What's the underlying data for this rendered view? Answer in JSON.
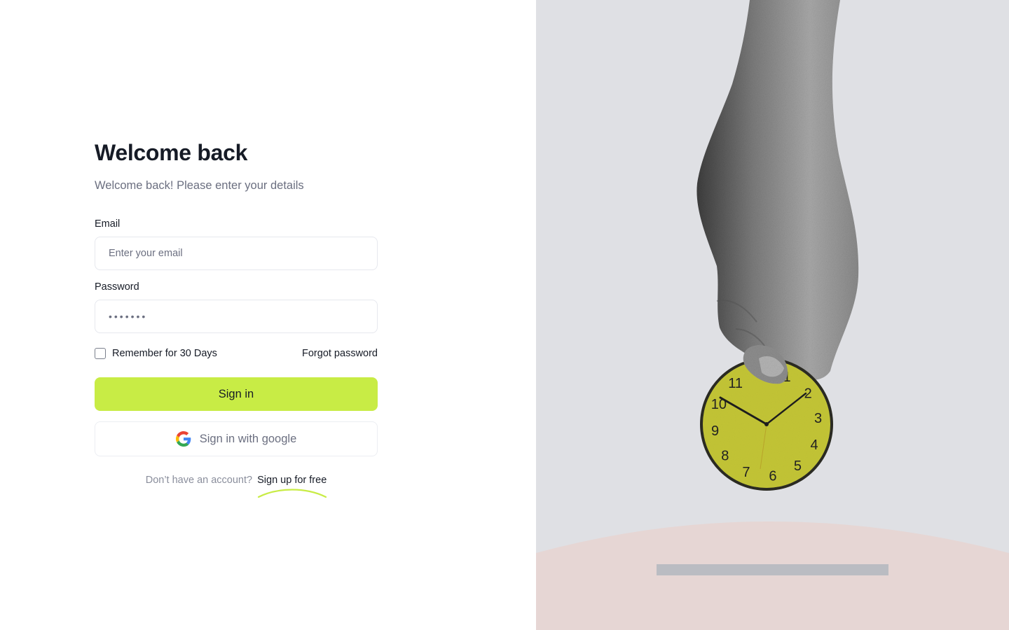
{
  "form": {
    "title": "Welcome back",
    "subtitle": "Welcome back! Please enter your details",
    "email_label": "Email",
    "email_placeholder": "Enter your email",
    "password_label": "Password",
    "password_value": "•••••••",
    "remember_label": "Remember for 30 Days",
    "remember_checked": false,
    "forgot_label": "Forgot password",
    "signin_label": "Sign in",
    "google_label": "Sign in with google",
    "signup_question": "Don’t have an account?",
    "signup_link": "Sign up for free"
  },
  "colors": {
    "accent": "#c8ec45",
    "text_primary": "#161b26",
    "text_muted": "#6b6f80",
    "panel_bg": "#dfe0e4",
    "floor": "#e6d6d4"
  },
  "illustration": {
    "clock_numbers": [
      "11",
      "1",
      "10",
      "2",
      "9",
      "3",
      "8",
      "4",
      "7",
      "5",
      "6"
    ]
  }
}
